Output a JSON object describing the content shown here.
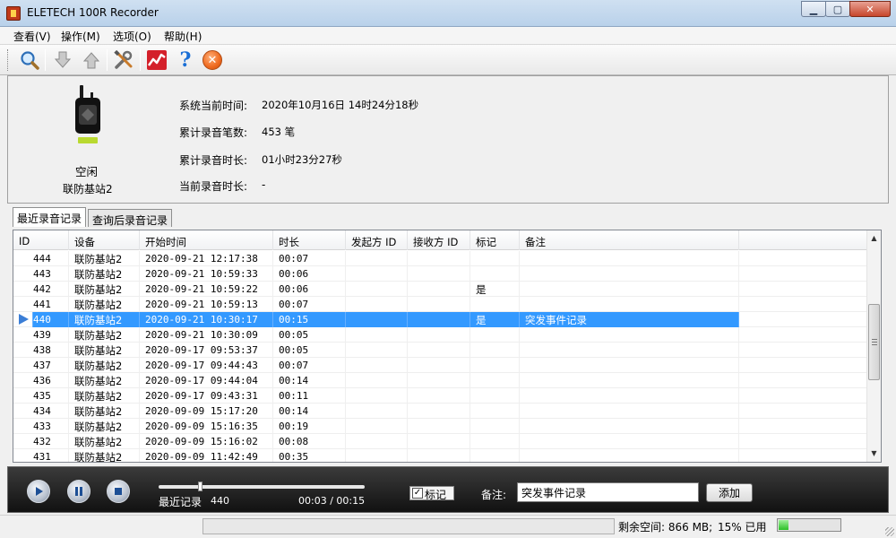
{
  "window": {
    "title": "ELETECH 100R Recorder",
    "minimize": "▁",
    "maximize": "▢",
    "close": "✕"
  },
  "menu": {
    "items": [
      "查看(V)",
      "操作(M)",
      "选项(O)",
      "帮助(H)"
    ]
  },
  "toolbar": {
    "icons": [
      "search-icon",
      "download-icon",
      "upload-icon",
      "settings-tools-icon",
      "chart-icon",
      "help-icon",
      "close-circle-icon"
    ],
    "help_glyph": "?",
    "close_glyph": "✕"
  },
  "device": {
    "status": "空闲",
    "name": "联防基站2"
  },
  "info": {
    "time_label": "系统当前时间:",
    "time_value": "2020年10月16日 14时24分18秒",
    "count_label": "累计录音笔数:",
    "count_value": "453 笔",
    "duration_label": "累计录音时长:",
    "duration_value": "01小时23分27秒",
    "current_label": "当前录音时长:",
    "current_value": "-"
  },
  "tabs": [
    "最近录音记录",
    "查询后录音记录"
  ],
  "table": {
    "columns": [
      "ID",
      "设备",
      "开始时间",
      "时长",
      "发起方 ID",
      "接收方 ID",
      "标记",
      "备注"
    ],
    "rows": [
      {
        "id": "444",
        "device": "联防基站2",
        "start": "2020-09-21 12:17:38",
        "duration": "00:07",
        "caller": "",
        "receiver": "",
        "mark": "",
        "note": ""
      },
      {
        "id": "443",
        "device": "联防基站2",
        "start": "2020-09-21 10:59:33",
        "duration": "00:06",
        "caller": "",
        "receiver": "",
        "mark": "",
        "note": ""
      },
      {
        "id": "442",
        "device": "联防基站2",
        "start": "2020-09-21 10:59:22",
        "duration": "00:06",
        "caller": "",
        "receiver": "",
        "mark": "是",
        "note": ""
      },
      {
        "id": "441",
        "device": "联防基站2",
        "start": "2020-09-21 10:59:13",
        "duration": "00:07",
        "caller": "",
        "receiver": "",
        "mark": "",
        "note": ""
      },
      {
        "id": "440",
        "device": "联防基站2",
        "start": "2020-09-21 10:30:17",
        "duration": "00:15",
        "caller": "",
        "receiver": "",
        "mark": "是",
        "note": "突发事件记录",
        "selected": true
      },
      {
        "id": "439",
        "device": "联防基站2",
        "start": "2020-09-21 10:30:09",
        "duration": "00:05",
        "caller": "",
        "receiver": "",
        "mark": "",
        "note": ""
      },
      {
        "id": "438",
        "device": "联防基站2",
        "start": "2020-09-17 09:53:37",
        "duration": "00:05",
        "caller": "",
        "receiver": "",
        "mark": "",
        "note": ""
      },
      {
        "id": "437",
        "device": "联防基站2",
        "start": "2020-09-17 09:44:43",
        "duration": "00:07",
        "caller": "",
        "receiver": "",
        "mark": "",
        "note": ""
      },
      {
        "id": "436",
        "device": "联防基站2",
        "start": "2020-09-17 09:44:04",
        "duration": "00:14",
        "caller": "",
        "receiver": "",
        "mark": "",
        "note": ""
      },
      {
        "id": "435",
        "device": "联防基站2",
        "start": "2020-09-17 09:43:31",
        "duration": "00:11",
        "caller": "",
        "receiver": "",
        "mark": "",
        "note": ""
      },
      {
        "id": "434",
        "device": "联防基站2",
        "start": "2020-09-09 15:17:20",
        "duration": "00:14",
        "caller": "",
        "receiver": "",
        "mark": "",
        "note": ""
      },
      {
        "id": "433",
        "device": "联防基站2",
        "start": "2020-09-09 15:16:35",
        "duration": "00:19",
        "caller": "",
        "receiver": "",
        "mark": "",
        "note": ""
      },
      {
        "id": "432",
        "device": "联防基站2",
        "start": "2020-09-09 15:16:02",
        "duration": "00:08",
        "caller": "",
        "receiver": "",
        "mark": "",
        "note": ""
      },
      {
        "id": "431",
        "device": "联防基站2",
        "start": "2020-09-09 11:42:49",
        "duration": "00:35",
        "caller": "",
        "receiver": "",
        "mark": "",
        "note": ""
      }
    ]
  },
  "scrollbar": {
    "up": "▲",
    "down": "▼"
  },
  "player": {
    "source_label": "最近记录",
    "record_id": "440",
    "time_display": "00:03 / 00:15",
    "progress": 0.2,
    "mark_label": "标记",
    "mark_checked": "✓",
    "note_label": "备注:",
    "note_value": "突发事件记录",
    "add_label": "添加"
  },
  "status": {
    "free_space": "剩余空间: 866 MB;",
    "used": "15% 已用",
    "used_fraction": 0.15
  },
  "colors": {
    "selection": "#3399ff",
    "player_bg": "#1e1e1e",
    "meter": "#2bbf26"
  }
}
